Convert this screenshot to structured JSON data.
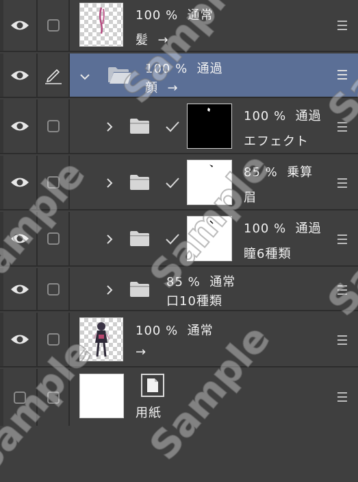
{
  "layers": [
    {
      "opacity": "100 %",
      "blend": "通常",
      "name": "髪",
      "arrow": "→"
    },
    {
      "opacity": "100 %",
      "blend": "通過",
      "name": "顔",
      "arrow": "→"
    },
    {
      "opacity": "100 %",
      "blend": "通過",
      "name": "エフェクト"
    },
    {
      "opacity": "85 %",
      "blend": "乗算",
      "name": "眉"
    },
    {
      "opacity": "100 %",
      "blend": "通過",
      "name": "瞳6種類"
    },
    {
      "opacity": "85 %",
      "blend": "通常",
      "name": "口10種類"
    },
    {
      "opacity": "100 %",
      "blend": "通常",
      "arrow": "→"
    },
    {
      "name": "用紙"
    }
  ],
  "watermark": "Sample",
  "colors": {
    "selected": "#5b6f96",
    "panel": "#3f3f3f",
    "divider": "#2c2c2c"
  },
  "icons": {
    "eye": "eye-icon",
    "pen": "pen-icon",
    "folder": "folder-icon",
    "chevron": "chevron-icon",
    "check": "check-icon",
    "menu": "menu-icon",
    "paper": "paper-icon"
  }
}
